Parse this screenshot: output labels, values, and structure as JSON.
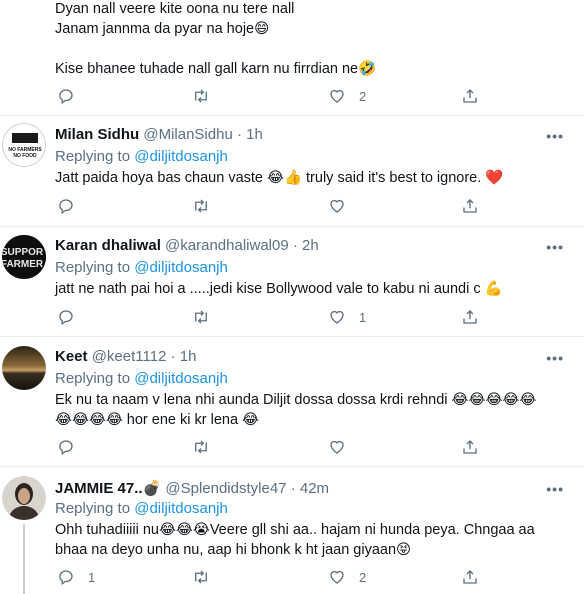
{
  "tweets": [
    {
      "lines": [
        "Dyan nall veere kite oona nu tere nall",
        "Janam jannma da pyar na hoje😄",
        "",
        "Kise bhanee tuhade nall gall karn nu firrdian ne🤣"
      ],
      "reply_count": "",
      "retweet_count": "",
      "like_count": "2"
    },
    {
      "name": "Milan Sidhu",
      "handle": "@MilanSidhu",
      "sep": "·",
      "time": "1h",
      "replying_prefix": "Replying to",
      "replying_to": "@diljitdosanjh",
      "lines": [
        "Jatt paida hoya bas chaun vaste 😂👍 truly said it's best to ignore. ❤️"
      ],
      "reply_count": "",
      "retweet_count": "",
      "like_count": "",
      "avatar_text": [
        "NO FARMERS",
        "NO FOOD"
      ]
    },
    {
      "name": "Karan dhaliwal",
      "handle": "@karandhaliwal09",
      "sep": "·",
      "time": "2h",
      "replying_prefix": "Replying to",
      "replying_to": "@diljitdosanjh",
      "lines": [
        "jatt ne nath pai hoi a .....jedi kise Bollywood vale to kabu ni aundi c 💪"
      ],
      "reply_count": "",
      "retweet_count": "",
      "like_count": "1",
      "avatar_text": [
        "SUPPOR",
        "FARMER"
      ]
    },
    {
      "name": "Keet",
      "handle": "@keet1112",
      "sep": "·",
      "time": "1h",
      "replying_prefix": "Replying to",
      "replying_to": "@diljitdosanjh",
      "lines": [
        "Ek nu ta naam v lena nhi aunda Diljit dossa dossa krdi rehndi 😂😂😂😂😂",
        "😂😂😂😂 hor ene ki kr lena 😂"
      ],
      "reply_count": "",
      "retweet_count": "",
      "like_count": ""
    },
    {
      "name": "JAMMIE 47..💣",
      "handle": "@Splendidstyle47",
      "sep": "·",
      "time": "42m",
      "replying_prefix": "Replying to",
      "replying_to": "@diljitdosanjh",
      "lines": [
        "Ohh tuhadiiiii nu😂😂😭Veere gll shi aa.. hajam ni hunda peya. Chngaa aa",
        "bhaa na deyo unha nu, aap hi bhonk k ht jaan giyaan😝"
      ],
      "reply_count": "1",
      "retweet_count": "",
      "like_count": "2"
    }
  ],
  "more_label": "•••",
  "icons": [
    "reply-icon",
    "retweet-icon",
    "like-icon",
    "share-icon",
    "more-icon"
  ],
  "colors": {
    "link": "#1b95e0",
    "secondary": "#5b7083",
    "text": "#0f1419",
    "border": "#ebeef0"
  }
}
